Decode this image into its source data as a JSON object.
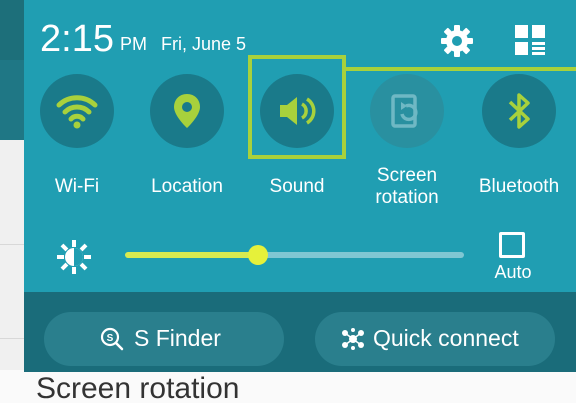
{
  "status_bar": {
    "time": "2:15",
    "ampm": "PM",
    "date": "Fri, June 5"
  },
  "header_icons": [
    "gear-icon",
    "quick-panel-grid-icon"
  ],
  "quick_settings": [
    {
      "label": "Wi-Fi",
      "icon": "wifi-icon",
      "active": true
    },
    {
      "label": "Location",
      "icon": "location-pin-icon",
      "active": true
    },
    {
      "label": "Sound",
      "icon": "speaker-icon",
      "active": true
    },
    {
      "label_line1": "Screen",
      "label_line2": "rotation",
      "icon": "screen-rotation-icon",
      "active": false
    },
    {
      "label": "Bluetooth",
      "icon": "bluetooth-icon",
      "active": true
    }
  ],
  "brightness": {
    "icon": "brightness-icon",
    "level": 0.4,
    "auto_label": "Auto",
    "auto_checked": false
  },
  "bottom_buttons": {
    "finder_label": "S Finder",
    "quick_connect_label": "Quick connect"
  },
  "background_text": "Screen rotation",
  "colors": {
    "panel": "#209eb2",
    "active_icon": "#a8d13c",
    "inactive_icon": "#6fb8c4",
    "highlight": "#a8d13c",
    "slider": "#d8ea50"
  }
}
